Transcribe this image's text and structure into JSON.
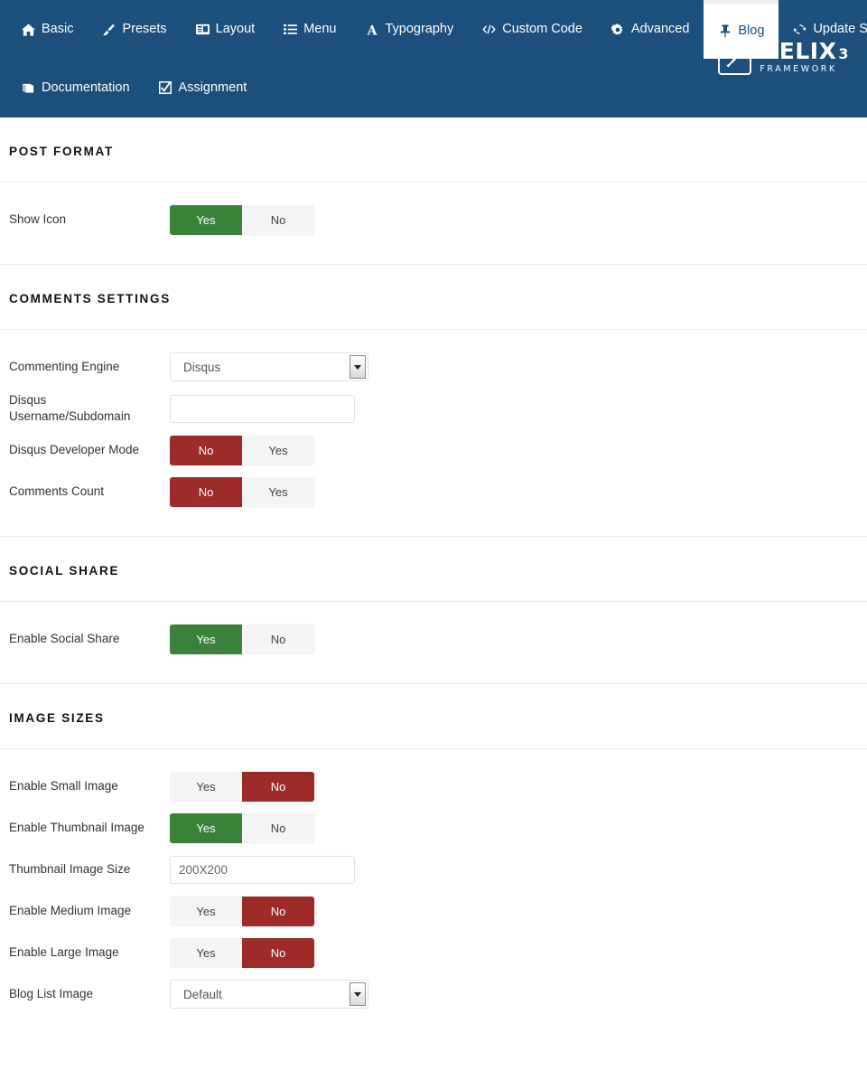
{
  "nav": {
    "row1": [
      {
        "label": "Basic",
        "icon": "home-icon",
        "active": false
      },
      {
        "label": "Presets",
        "icon": "brush-icon",
        "active": false
      },
      {
        "label": "Layout",
        "icon": "layout-icon",
        "active": false
      },
      {
        "label": "Menu",
        "icon": "list-icon",
        "active": false
      },
      {
        "label": "Typography",
        "icon": "font-icon",
        "active": false
      },
      {
        "label": "Custom Code",
        "icon": "code-icon",
        "active": false
      },
      {
        "label": "Advanced",
        "icon": "gear-icon",
        "active": false
      },
      {
        "label": "Blog",
        "icon": "pin-icon",
        "active": true
      },
      {
        "label": "Update Settings",
        "icon": "refresh-icon",
        "active": false
      }
    ],
    "row2": [
      {
        "label": "Documentation",
        "icon": "book-icon",
        "active": false
      },
      {
        "label": "Assignment",
        "icon": "checkbox-icon",
        "active": false
      }
    ]
  },
  "logo": {
    "title": "HELIX",
    "superscript": "3",
    "subtitle": "FRAMEWORK"
  },
  "colors": {
    "header_blue": "#1c4f7c",
    "toggle_green": "#3a8139",
    "toggle_red": "#9d2b28",
    "toggle_off": "#f4f4f4"
  },
  "sections": [
    {
      "title": "POST FORMAT",
      "fields": [
        {
          "label": "Show Icon",
          "type": "toggle",
          "options": [
            "Yes",
            "No"
          ],
          "active_index": 0,
          "active_state": "green"
        }
      ]
    },
    {
      "title": "COMMENTS SETTINGS",
      "fields": [
        {
          "label": "Commenting Engine",
          "type": "select",
          "value": "Disqus"
        },
        {
          "label": "Disqus Username/Subdomain",
          "type": "text",
          "value": "",
          "placeholder": ""
        },
        {
          "label": "Disqus Developer Mode",
          "type": "toggle",
          "options": [
            "No",
            "Yes"
          ],
          "active_index": 0,
          "active_state": "red"
        },
        {
          "label": "Comments Count",
          "type": "toggle",
          "options": [
            "No",
            "Yes"
          ],
          "active_index": 0,
          "active_state": "red"
        }
      ]
    },
    {
      "title": "SOCIAL SHARE",
      "fields": [
        {
          "label": "Enable Social Share",
          "type": "toggle",
          "options": [
            "Yes",
            "No"
          ],
          "active_index": 0,
          "active_state": "green"
        }
      ]
    },
    {
      "title": "IMAGE SIZES",
      "fields": [
        {
          "label": "Enable Small Image",
          "type": "toggle",
          "options": [
            "Yes",
            "No"
          ],
          "active_index": 1,
          "active_state": "red"
        },
        {
          "label": "Enable Thumbnail Image",
          "type": "toggle",
          "options": [
            "Yes",
            "No"
          ],
          "active_index": 0,
          "active_state": "green"
        },
        {
          "label": "Thumbnail Image Size",
          "type": "text",
          "value": "",
          "placeholder": "200X200"
        },
        {
          "label": "Enable Medium Image",
          "type": "toggle",
          "options": [
            "Yes",
            "No"
          ],
          "active_index": 1,
          "active_state": "red"
        },
        {
          "label": "Enable Large Image",
          "type": "toggle",
          "options": [
            "Yes",
            "No"
          ],
          "active_index": 1,
          "active_state": "red"
        },
        {
          "label": "Blog List Image",
          "type": "select",
          "value": "Default"
        }
      ]
    }
  ]
}
